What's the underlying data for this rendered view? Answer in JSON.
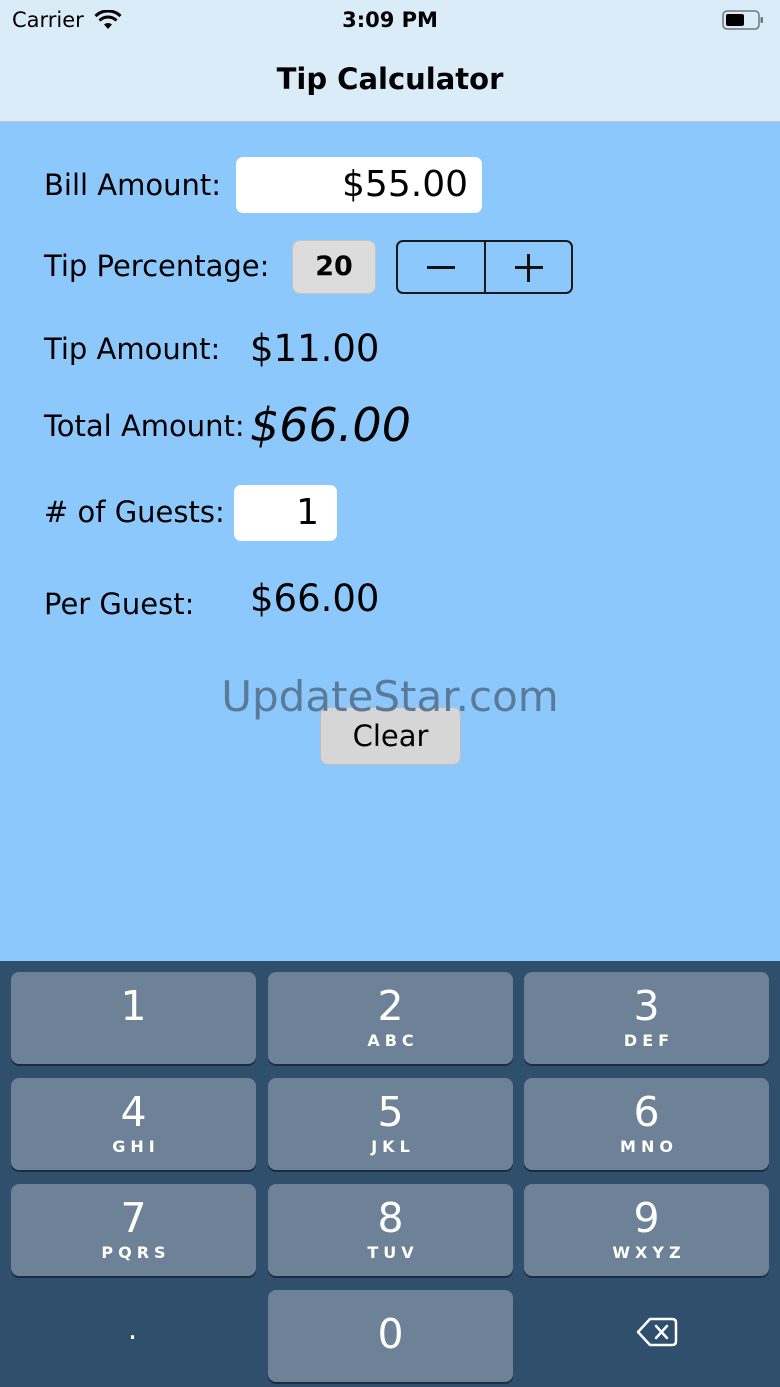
{
  "status_bar": {
    "carrier": "Carrier",
    "time": "3:09 PM",
    "wifi_icon": "wifi-icon",
    "battery_icon": "battery-icon"
  },
  "nav": {
    "title": "Tip Calculator"
  },
  "form": {
    "bill_label": "Bill Amount:",
    "bill_value": "$55.00",
    "tip_pct_label": "Tip Percentage:",
    "tip_pct_value": "20",
    "tip_amount_label": "Tip Amount:",
    "tip_amount_value": "$11.00",
    "total_label": "Total Amount:",
    "total_value": "$66.00",
    "guests_label": "# of Guests:",
    "guests_value": "1",
    "per_guest_label": "Per Guest:",
    "per_guest_value": "$66.00",
    "clear_label": "Clear"
  },
  "watermark": "UpdateStar.com",
  "keypad": {
    "keys": [
      {
        "digit": "1",
        "letters": ""
      },
      {
        "digit": "2",
        "letters": "ABC"
      },
      {
        "digit": "3",
        "letters": "DEF"
      },
      {
        "digit": "4",
        "letters": "GHI"
      },
      {
        "digit": "5",
        "letters": "JKL"
      },
      {
        "digit": "6",
        "letters": "MNO"
      },
      {
        "digit": "7",
        "letters": "PQRS"
      },
      {
        "digit": "8",
        "letters": "TUV"
      },
      {
        "digit": "9",
        "letters": "WXYZ"
      }
    ],
    "zero": "0",
    "dot": ".",
    "delete_icon": "backspace-icon"
  },
  "colors": {
    "background": "#8cc8fc",
    "nav_background": "#d9ecf8",
    "keypad_background": "#2f4f6c",
    "key_background": "#6d8197"
  }
}
